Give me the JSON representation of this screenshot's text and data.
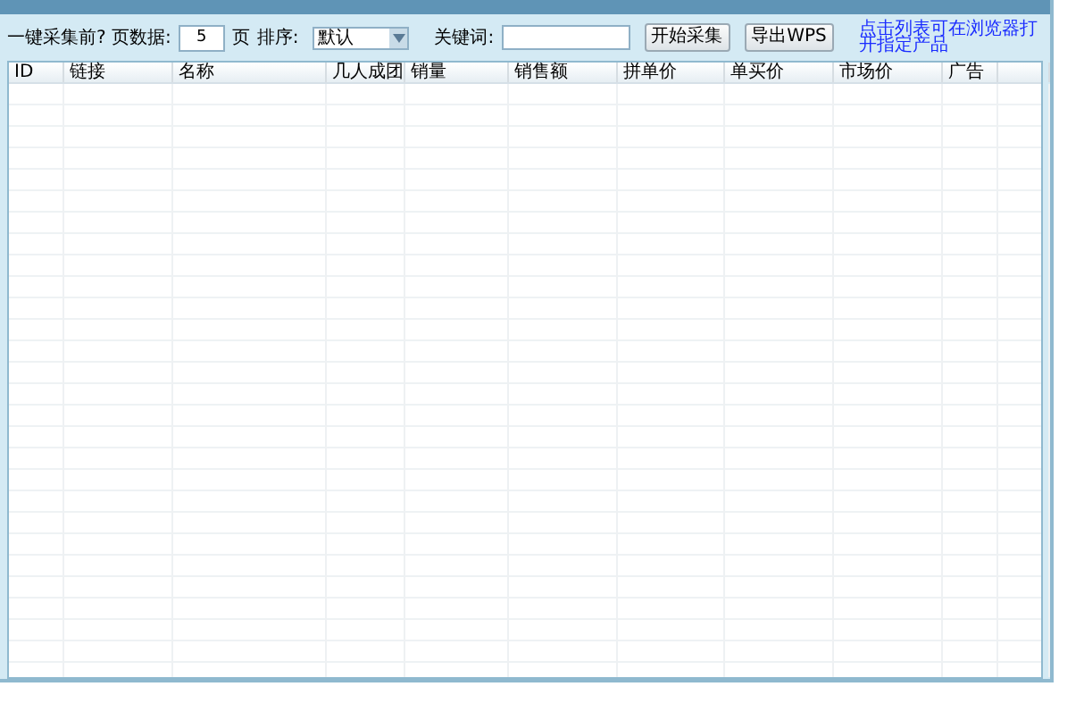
{
  "toolbar": {
    "pages_label": "一键采集前? 页数据:",
    "pages_value": "5",
    "pages_unit": "页",
    "sort_label": "排序:",
    "sort_value": "默认",
    "keyword_label": "关键词:",
    "buttons": [
      "开始采集",
      "导出WPS"
    ],
    "hint": "点击列表可在浏览器打开指定产品"
  },
  "table": {
    "columns": [
      "ID",
      "链接",
      "名称",
      "几人成团",
      "销量",
      "销售额",
      "拼单价",
      "单买价",
      "市场价",
      "广告"
    ]
  }
}
